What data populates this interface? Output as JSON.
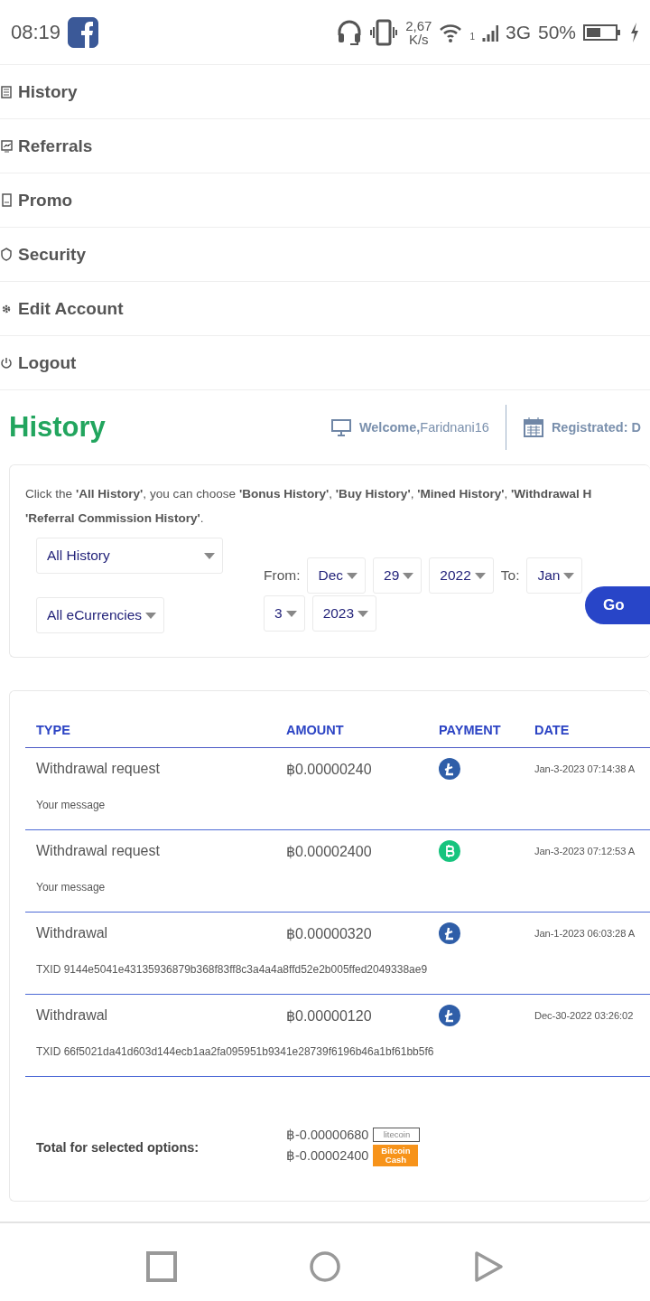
{
  "status_bar": {
    "time": "08:19",
    "speed_value": "2,67",
    "speed_unit": "K/s",
    "sim_slot": "1",
    "network": "3G",
    "battery": "50%"
  },
  "menu": {
    "items": [
      {
        "label": "History"
      },
      {
        "label": "Referrals"
      },
      {
        "label": "Promo"
      },
      {
        "label": "Security"
      },
      {
        "label": "Edit Account"
      },
      {
        "label": "Logout"
      }
    ]
  },
  "header": {
    "title": "History",
    "welcome_label": "Welcome,",
    "username": "Faridnani16",
    "registered_label": "Registrated: D"
  },
  "filter": {
    "intro_lines": [
      "Click the **'All History'**, you can choose **'Bonus History'**, **'Buy History'**, **'Mined History'**, **'Withdrawal H**",
      "**'Referral Commission History'**."
    ],
    "history_type": "All History",
    "currency": "All eCurrencies",
    "from_label": "From:",
    "from_month": "Dec",
    "from_day": "29",
    "from_year": "2022",
    "to_label": "To:",
    "to_month": "Jan",
    "to_day": "3",
    "to_year": "2023",
    "go_button": "Go"
  },
  "table": {
    "columns": [
      "TYPE",
      "AMOUNT",
      "PAYMENT",
      "DATE"
    ],
    "rows": [
      {
        "type": "Withdrawal request",
        "amount": "฿0.00000240",
        "kind": "litecoin",
        "date": "Jan-3-2023 07:14:38 A",
        "note": "Your message"
      },
      {
        "type": "Withdrawal request",
        "amount": "฿0.00002400",
        "kind": "bitcoin-cash",
        "date": "Jan-3-2023 07:12:53 A",
        "note": "Your message"
      },
      {
        "type": "Withdrawal",
        "amount": "฿0.00000320",
        "kind": "litecoin",
        "date": "Jan-1-2023 06:03:28 A",
        "note": "TXID 9144e5041e43135936879b368f83ff8c3a4a4a8ffd52e2b005ffed2049338ae9"
      },
      {
        "type": "Withdrawal",
        "amount": "฿0.00000120",
        "kind": "litecoin",
        "date": "Dec-30-2022 03:26:02",
        "note": "TXID 66f5021da41d603d144ecb1aa2fa095951b9341e28739f6196b46a1bf61bb5f6"
      }
    ],
    "total_label": "Total for selected options:",
    "totals": [
      {
        "amount": "฿-0.00000680",
        "kind": "litecoin",
        "logo_text": "litecoin"
      },
      {
        "amount": "฿-0.00002400",
        "kind": "bitcoin-cash",
        "logo_text": "Bitcoin Cash"
      }
    ]
  }
}
